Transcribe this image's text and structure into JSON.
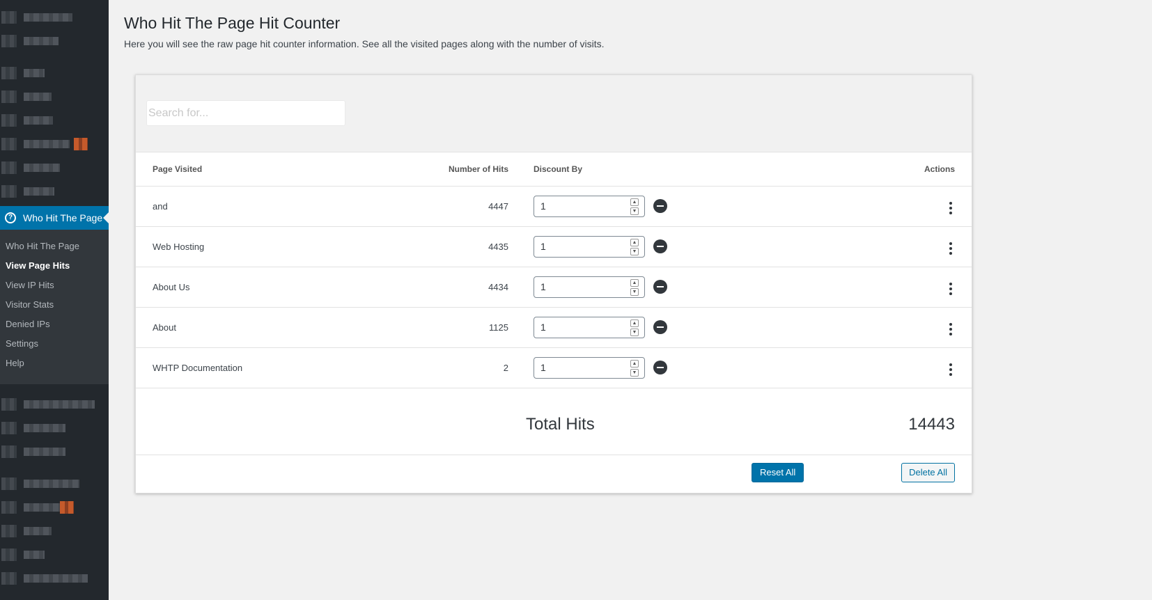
{
  "sidebar": {
    "active_menu": {
      "label": "Who Hit The Page",
      "icon": "help-circle-icon"
    },
    "submenu": [
      {
        "label": "Who Hit The Page",
        "current": false
      },
      {
        "label": "View Page Hits",
        "current": true
      },
      {
        "label": "View IP Hits",
        "current": false
      },
      {
        "label": "Visitor Stats",
        "current": false
      },
      {
        "label": "Denied IPs",
        "current": false
      },
      {
        "label": "Settings",
        "current": false
      },
      {
        "label": "Help",
        "current": false
      }
    ]
  },
  "header": {
    "title": "Who Hit The Page Hit Counter",
    "description": "Here you will see the raw page hit counter information. See all the visited pages along with the number of visits."
  },
  "search": {
    "placeholder": "Search for...",
    "value": ""
  },
  "table": {
    "columns": {
      "page": "Page Visited",
      "hits": "Number of Hits",
      "discount": "Discount By",
      "actions": "Actions"
    },
    "rows": [
      {
        "page": "and",
        "hits": "4447",
        "discount": "1"
      },
      {
        "page": "Web Hosting",
        "hits": "4435",
        "discount": "1"
      },
      {
        "page": "About Us",
        "hits": "4434",
        "discount": "1"
      },
      {
        "page": "About",
        "hits": "1125",
        "discount": "1"
      },
      {
        "page": "WHTP Documentation",
        "hits": "2",
        "discount": "1"
      }
    ]
  },
  "total": {
    "label": "Total Hits",
    "value": "14443"
  },
  "footer": {
    "reset_label": "Reset All",
    "delete_label": "Delete All"
  },
  "colors": {
    "accent": "#0073aa",
    "sidebar_bg": "#23282d",
    "submenu_bg": "#32373c"
  }
}
